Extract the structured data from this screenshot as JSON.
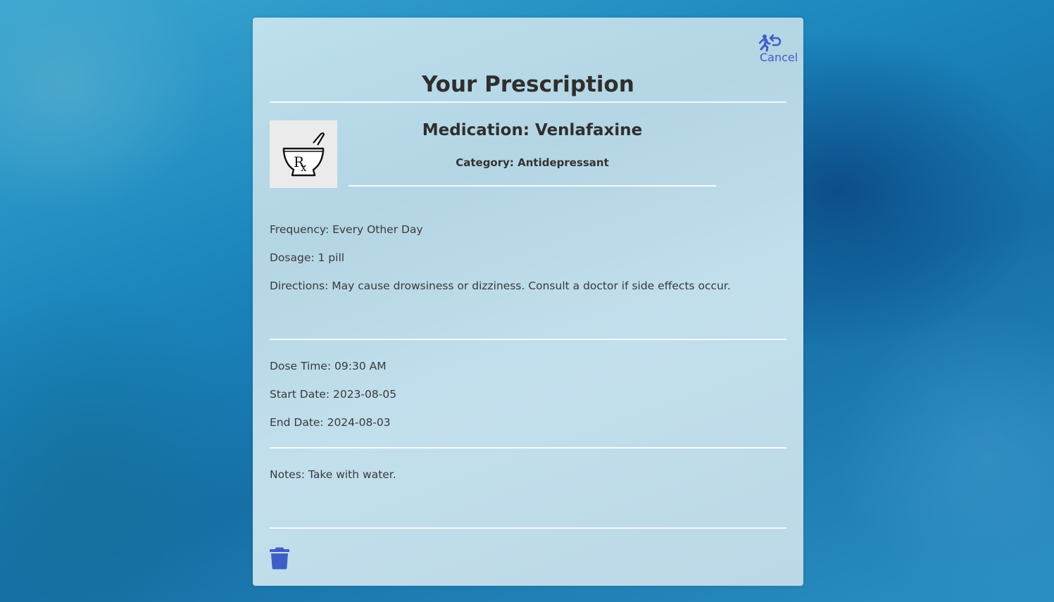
{
  "header": {
    "title": "Your Prescription",
    "cancel_label": "Cancel",
    "cancel_icon": "running-person-return-icon"
  },
  "medication": {
    "image_icon": "mortar-pestle-rx-icon",
    "name": "Medication: Venlafaxine",
    "category": "Category: Antidepressant"
  },
  "details": {
    "frequency": "Frequency: Every Other Day",
    "dosage": "Dosage: 1 pill",
    "directions": "Directions: May cause drowsiness or dizziness. Consult a doctor if side effects occur."
  },
  "schedule": {
    "dose_time": "Dose Time: 09:30 AM",
    "start_date": "Start Date: 2023-08-05",
    "end_date": "End Date: 2024-08-03"
  },
  "notes": "Notes: Take with water.",
  "actions": {
    "delete_icon": "trash-icon"
  },
  "colors": {
    "accent": "#3e5ec6",
    "text": "#2f2f2f"
  }
}
